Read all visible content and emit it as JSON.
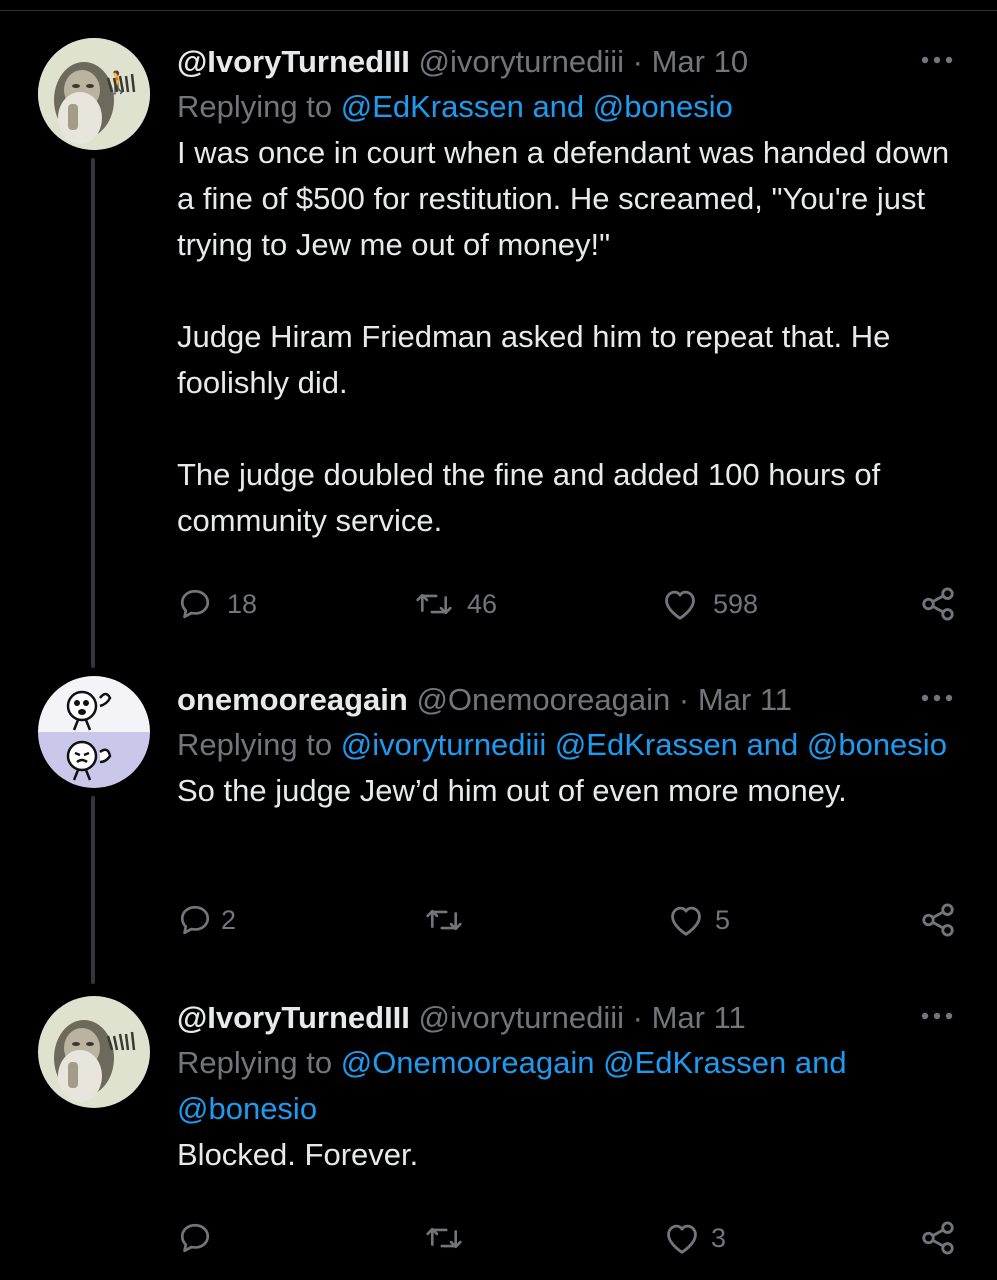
{
  "tweets": [
    {
      "name": "@IvoryTurnedIII",
      "handle": "@ivoryturnediii",
      "separator": "·",
      "date": "Mar 10",
      "reply_prefix": "Replying to",
      "reply_links": "@EdKrassen and @bonesio",
      "text": "I was once in court when a defendant was handed down a fine of $500 for restitution. He screamed, \"You're just trying to Jew me out of money!\"\n\nJudge Hiram Friedman asked him to repeat that. He foolishly did.\n\nThe judge doubled the fine and added 100 hours of community service.",
      "replies": "18",
      "retweets": "46",
      "likes": "598"
    },
    {
      "name": "onemooreagain",
      "handle": "@Onemooreagain",
      "separator": "·",
      "date": "Mar 11",
      "reply_prefix": "Replying to",
      "reply_links": "@ivoryturnediii @EdKrassen and @bonesio",
      "text": "So the judge Jew’d him out of even more money.",
      "replies": "2",
      "retweets": "",
      "likes": "5"
    },
    {
      "name": "@IvoryTurnedIII",
      "handle": "@ivoryturnediii",
      "separator": "·",
      "date": "Mar 11",
      "reply_prefix": "Replying to",
      "reply_links": "@Onemooreagain @EdKrassen and @bonesio",
      "text": "Blocked. Forever.",
      "replies": "",
      "retweets": "",
      "likes": "3"
    }
  ],
  "icons": {
    "reply": "reply-icon",
    "retweet": "retweet-icon",
    "like": "heart-icon",
    "share": "share-icon",
    "more": "more-icon"
  },
  "colors": {
    "background": "#000000",
    "text": "#e7e9ea",
    "secondary": "#71767b",
    "link": "#1d9bf0"
  }
}
